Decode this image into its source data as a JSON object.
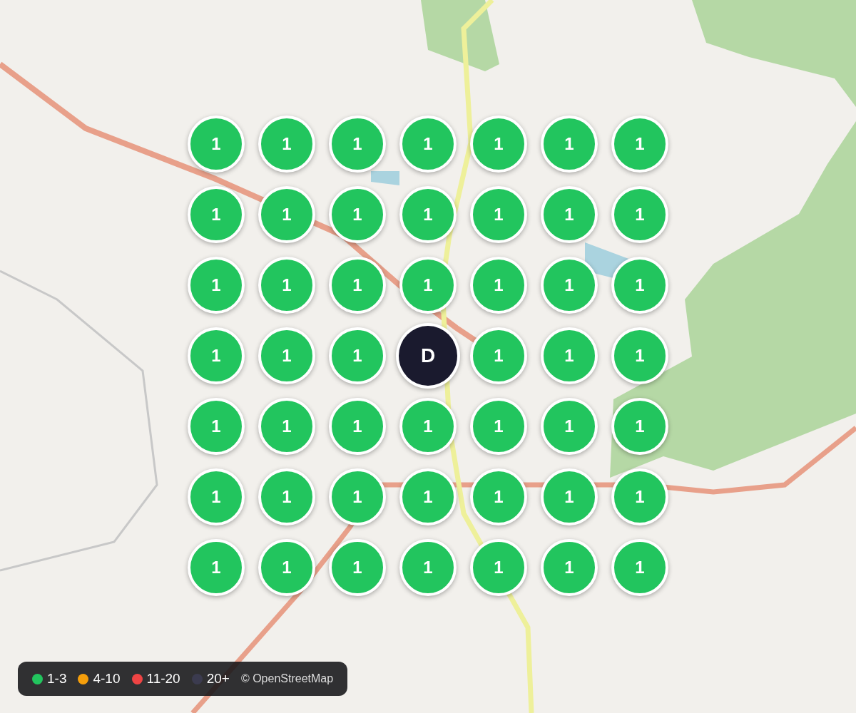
{
  "markers": [
    [
      {
        "kind": "cluster",
        "label": "1"
      },
      {
        "kind": "cluster",
        "label": "1"
      },
      {
        "kind": "cluster",
        "label": "1"
      },
      {
        "kind": "cluster",
        "label": "1"
      },
      {
        "kind": "cluster",
        "label": "1"
      },
      {
        "kind": "cluster",
        "label": "1"
      },
      {
        "kind": "cluster",
        "label": "1"
      }
    ],
    [
      {
        "kind": "cluster",
        "label": "1"
      },
      {
        "kind": "cluster",
        "label": "1"
      },
      {
        "kind": "cluster",
        "label": "1"
      },
      {
        "kind": "cluster",
        "label": "1"
      },
      {
        "kind": "cluster",
        "label": "1"
      },
      {
        "kind": "cluster",
        "label": "1"
      },
      {
        "kind": "cluster",
        "label": "1"
      }
    ],
    [
      {
        "kind": "cluster",
        "label": "1"
      },
      {
        "kind": "cluster",
        "label": "1"
      },
      {
        "kind": "cluster",
        "label": "1"
      },
      {
        "kind": "cluster",
        "label": "1"
      },
      {
        "kind": "cluster",
        "label": "1"
      },
      {
        "kind": "cluster",
        "label": "1"
      },
      {
        "kind": "cluster",
        "label": "1"
      }
    ],
    [
      {
        "kind": "cluster",
        "label": "1"
      },
      {
        "kind": "cluster",
        "label": "1"
      },
      {
        "kind": "cluster",
        "label": "1"
      },
      {
        "kind": "destination",
        "label": "D"
      },
      {
        "kind": "cluster",
        "label": "1"
      },
      {
        "kind": "cluster",
        "label": "1"
      },
      {
        "kind": "cluster",
        "label": "1"
      }
    ],
    [
      {
        "kind": "cluster",
        "label": "1"
      },
      {
        "kind": "cluster",
        "label": "1"
      },
      {
        "kind": "cluster",
        "label": "1"
      },
      {
        "kind": "cluster",
        "label": "1"
      },
      {
        "kind": "cluster",
        "label": "1"
      },
      {
        "kind": "cluster",
        "label": "1"
      },
      {
        "kind": "cluster",
        "label": "1"
      }
    ],
    [
      {
        "kind": "cluster",
        "label": "1"
      },
      {
        "kind": "cluster",
        "label": "1"
      },
      {
        "kind": "cluster",
        "label": "1"
      },
      {
        "kind": "cluster",
        "label": "1"
      },
      {
        "kind": "cluster",
        "label": "1"
      },
      {
        "kind": "cluster",
        "label": "1"
      },
      {
        "kind": "cluster",
        "label": "1"
      }
    ],
    [
      {
        "kind": "cluster",
        "label": "1"
      },
      {
        "kind": "cluster",
        "label": "1"
      },
      {
        "kind": "cluster",
        "label": "1"
      },
      {
        "kind": "cluster",
        "label": "1"
      },
      {
        "kind": "cluster",
        "label": "1"
      },
      {
        "kind": "cluster",
        "label": "1"
      },
      {
        "kind": "cluster",
        "label": "1"
      }
    ]
  ],
  "legend": {
    "items": [
      {
        "label": "1-3",
        "color": "#22c55e"
      },
      {
        "label": "4-10",
        "color": "#f59e0b"
      },
      {
        "label": "11-20",
        "color": "#ef4444"
      },
      {
        "label": "20+",
        "color": "#3b3b4f"
      }
    ],
    "attribution": "© OpenStreetMap"
  }
}
